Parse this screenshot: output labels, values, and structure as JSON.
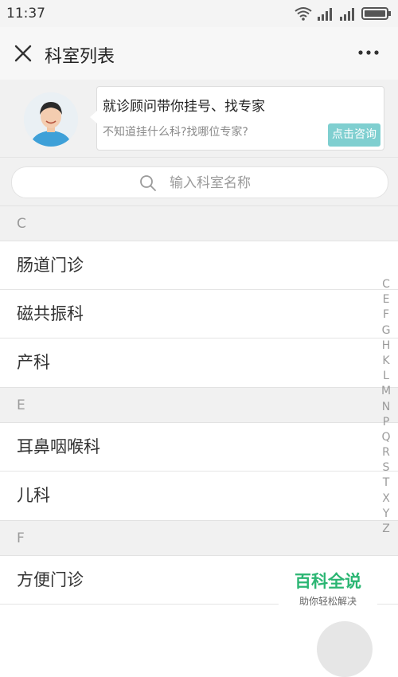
{
  "status_bar": {
    "time": "11:37"
  },
  "nav": {
    "title": "科室列表"
  },
  "consult": {
    "headline": "就诊顾问带你挂号、找专家",
    "sub": "不知道挂什么科?找哪位专家?",
    "cta": "点击咨询"
  },
  "search": {
    "placeholder": "输入科室名称"
  },
  "sections": [
    {
      "letter": "C",
      "items": [
        "肠道门诊",
        "磁共振科",
        "产科"
      ]
    },
    {
      "letter": "E",
      "items": [
        "耳鼻咽喉科",
        "儿科"
      ]
    },
    {
      "letter": "F",
      "items": [
        "方便门诊"
      ]
    }
  ],
  "index_letters": [
    "C",
    "E",
    "F",
    "G",
    "H",
    "K",
    "L",
    "M",
    "N",
    "P",
    "Q",
    "R",
    "S",
    "T",
    "X",
    "Y",
    "Z"
  ],
  "watermark": {
    "line1": "百科全说",
    "line2": "助你轻松解决"
  },
  "colors": {
    "accent": "#7fcfd0",
    "watermark_green": "#2bb673"
  }
}
